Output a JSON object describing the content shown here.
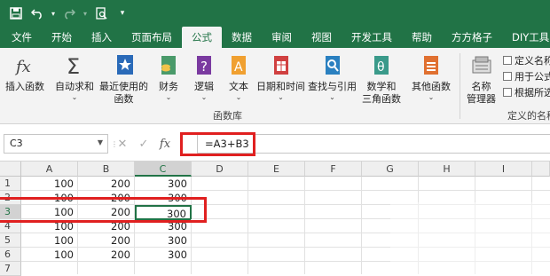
{
  "qat": {
    "icons": [
      "save-icon",
      "undo-icon",
      "redo-icon",
      "print-preview-icon",
      "customize-icon"
    ]
  },
  "tabs": [
    "文件",
    "开始",
    "插入",
    "页面布局",
    "公式",
    "数据",
    "审阅",
    "视图",
    "开发工具",
    "帮助",
    "方方格子",
    "DIY工具"
  ],
  "active_tab": "公式",
  "ribbon": {
    "insert_function": "插入函数",
    "autosum": "自动求和",
    "recent_1": "最近使用的",
    "recent_2": "函数",
    "finance": "财务",
    "logic": "逻辑",
    "text": "文本",
    "datetime": "日期和时间",
    "lookup": "查找与引用",
    "math_1": "数学和",
    "math_2": "三角函数",
    "other": "其他函数",
    "name_mgr_1": "名称",
    "name_mgr_2": "管理器",
    "define_name": "定义名称",
    "use_in_formula": "用于公式",
    "create_from_sel": "根据所选",
    "group_function_lib": "函数库",
    "group_defined_names": "定义的名称",
    "dropdown_caret": "⌄"
  },
  "formula_bar": {
    "name_box": "C3",
    "cancel": "✕",
    "enter": "✓",
    "fx": "fx",
    "dots": "⋮",
    "formula": "=A3+B3"
  },
  "sheet": {
    "columns": [
      "A",
      "B",
      "C",
      "D",
      "E",
      "F",
      "G",
      "H",
      "I"
    ],
    "rows": [
      "1",
      "2",
      "3",
      "4",
      "5",
      "6",
      "7"
    ],
    "cells": [
      [
        "100",
        "200",
        "300"
      ],
      [
        "100",
        "200",
        "300"
      ],
      [
        "100",
        "200",
        "300"
      ],
      [
        "100",
        "200",
        "300"
      ],
      [
        "100",
        "200",
        "300"
      ],
      [
        "100",
        "200",
        "300"
      ],
      [
        "",
        "",
        ""
      ]
    ],
    "active_cell": "C3"
  },
  "colors": {
    "accent": "#217346",
    "highlight": "#e02020"
  }
}
